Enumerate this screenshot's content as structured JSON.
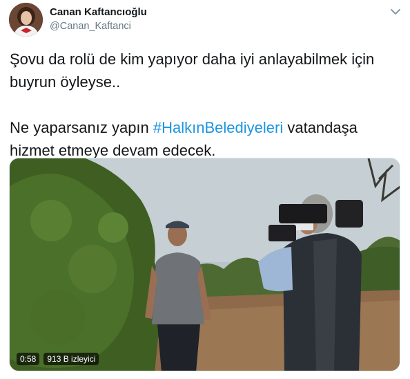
{
  "author": {
    "name": "Canan Kaftancıoğlu",
    "handle": "@Canan_Kaftanci",
    "avatar_icon": "profile-photo"
  },
  "tweet": {
    "line1": "Şovu da rolü de kim yapıyor daha iyi anlayabilmek için",
    "line2": "buyrun öyleyse..",
    "line3_prefix": "Ne yaparsanız yapın ",
    "hashtag": "#HalkınBelediyeleri",
    "line3_suffix": " vatandaşa",
    "line4": "hizmet etmeye devam edecek.",
    "hashtag_color": "#1b95e0"
  },
  "video": {
    "duration": "0:58",
    "views": "913 B izleyici"
  },
  "menu_icon": "chevron-down-icon"
}
